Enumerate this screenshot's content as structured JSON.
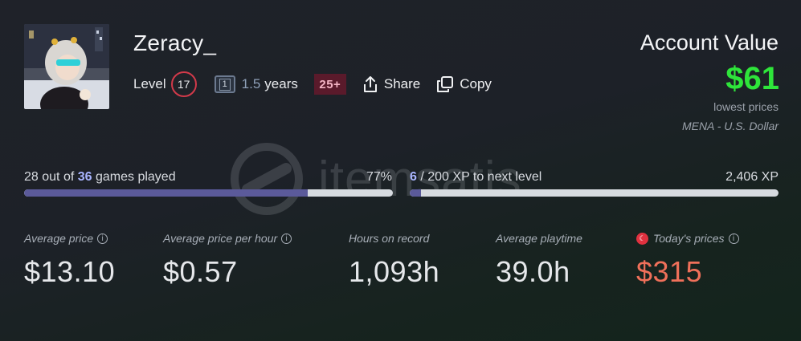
{
  "profile": {
    "username": "Zeracy_",
    "level_label": "Level",
    "level": "17",
    "years_icon_text": "1",
    "years_value": "1.5",
    "years_unit": "years",
    "age_badge": "25+",
    "share_label": "Share",
    "copy_label": "Copy"
  },
  "account": {
    "title": "Account Value",
    "value": "$61",
    "subtitle": "lowest prices",
    "region": "MENA - U.S. Dollar"
  },
  "watermark": {
    "text": "itemsatis"
  },
  "games": {
    "played": "28",
    "out_of": "out of",
    "total": "36",
    "suffix": "games played",
    "percent_label": "77%",
    "percent": 0.77
  },
  "xp": {
    "current": "6",
    "rest": "/ 200 XP to next level",
    "total": "2,406 XP",
    "fraction": 0.03
  },
  "stats": {
    "avg_price_label": "Average price",
    "avg_price": "$13.10",
    "avg_hour_label": "Average price per hour",
    "avg_hour": "$0.57",
    "hours_label": "Hours on record",
    "hours": "1,093h",
    "avg_play_label": "Average playtime",
    "avg_play": "39.0h",
    "today_label": "Today's prices",
    "today": "$315"
  },
  "colors": {
    "account_value": "#2ee53a",
    "today_price": "#f0705a",
    "progress_fill": "#5b5a9a",
    "level_ring": "#d23a4a"
  }
}
